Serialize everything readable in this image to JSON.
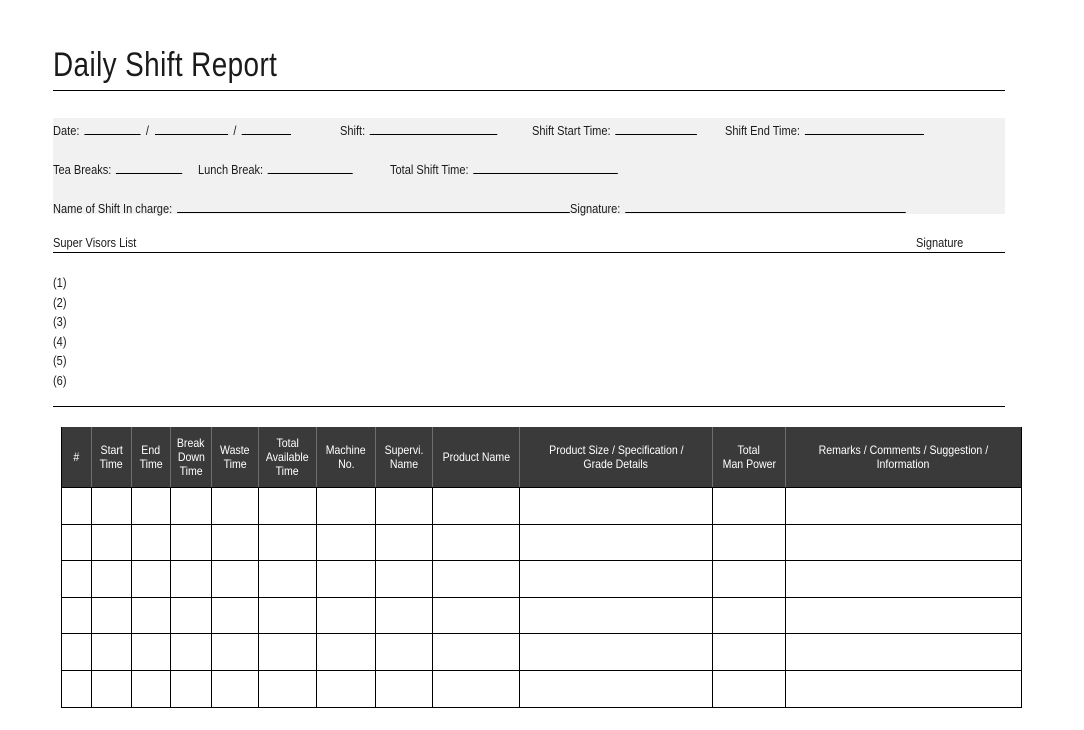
{
  "document": {
    "title": "Daily Shift Report"
  },
  "form": {
    "date_label": "Date:",
    "date_separator": "/",
    "shift_label": "Shift:",
    "shift_start_label": "Shift Start Time:",
    "shift_end_label": "Shift End Time:",
    "tea_breaks_label": "Tea Breaks:",
    "lunch_break_label": "Lunch Break:",
    "total_shift_time_label": "Total Shift Time:",
    "name_of_shift_incharge_label": "Name of Shift In charge:",
    "signature_label": "Signature:"
  },
  "supervisors": {
    "heading": "Super Visors List",
    "signature_heading": "Signature",
    "items": [
      "(1)",
      "(2)",
      "(3)",
      "(4)",
      "(5)",
      "(6)"
    ]
  },
  "table": {
    "columns": [
      {
        "label": "#",
        "lines": [
          "#"
        ]
      },
      {
        "label": "Start Time",
        "lines": [
          "Start",
          "Time"
        ]
      },
      {
        "label": "End Time",
        "lines": [
          "End",
          "Time"
        ]
      },
      {
        "label": "Break Down Time",
        "lines": [
          "Break",
          "Down",
          "Time"
        ]
      },
      {
        "label": "Waste Time",
        "lines": [
          "Waste",
          "Time"
        ]
      },
      {
        "label": "Total Available Time",
        "lines": [
          "Total",
          "Available",
          "Time"
        ]
      },
      {
        "label": "Machine No.",
        "lines": [
          "Machine",
          "No."
        ]
      },
      {
        "label": "Supervi. Name",
        "lines": [
          "Supervi.",
          "Name"
        ]
      },
      {
        "label": "Product Name",
        "lines": [
          "Product Name"
        ]
      },
      {
        "label": "Product Size / Specification / Grade Details",
        "lines": [
          "Product Size / Specification /",
          "Grade Details"
        ]
      },
      {
        "label": "Total Man Power",
        "lines": [
          "Total",
          "Man Power"
        ]
      },
      {
        "label": "Remarks / Comments / Suggestion / Information",
        "lines": [
          "Remarks / Comments / Suggestion /",
          "Information"
        ]
      }
    ],
    "row_count": 6,
    "rows": [
      [
        "",
        "",
        "",
        "",
        "",
        "",
        "",
        "",
        "",
        "",
        "",
        ""
      ],
      [
        "",
        "",
        "",
        "",
        "",
        "",
        "",
        "",
        "",
        "",
        "",
        ""
      ],
      [
        "",
        "",
        "",
        "",
        "",
        "",
        "",
        "",
        "",
        "",
        "",
        ""
      ],
      [
        "",
        "",
        "",
        "",
        "",
        "",
        "",
        "",
        "",
        "",
        "",
        ""
      ],
      [
        "",
        "",
        "",
        "",
        "",
        "",
        "",
        "",
        "",
        "",
        "",
        ""
      ],
      [
        "",
        "",
        "",
        "",
        "",
        "",
        "",
        "",
        "",
        "",
        "",
        ""
      ]
    ]
  },
  "colors": {
    "header_background": "#3a3a3a",
    "header_text": "#ffffff",
    "panel_background": "#f1f1f1",
    "rule": "#000000",
    "page_background": "#ffffff"
  }
}
